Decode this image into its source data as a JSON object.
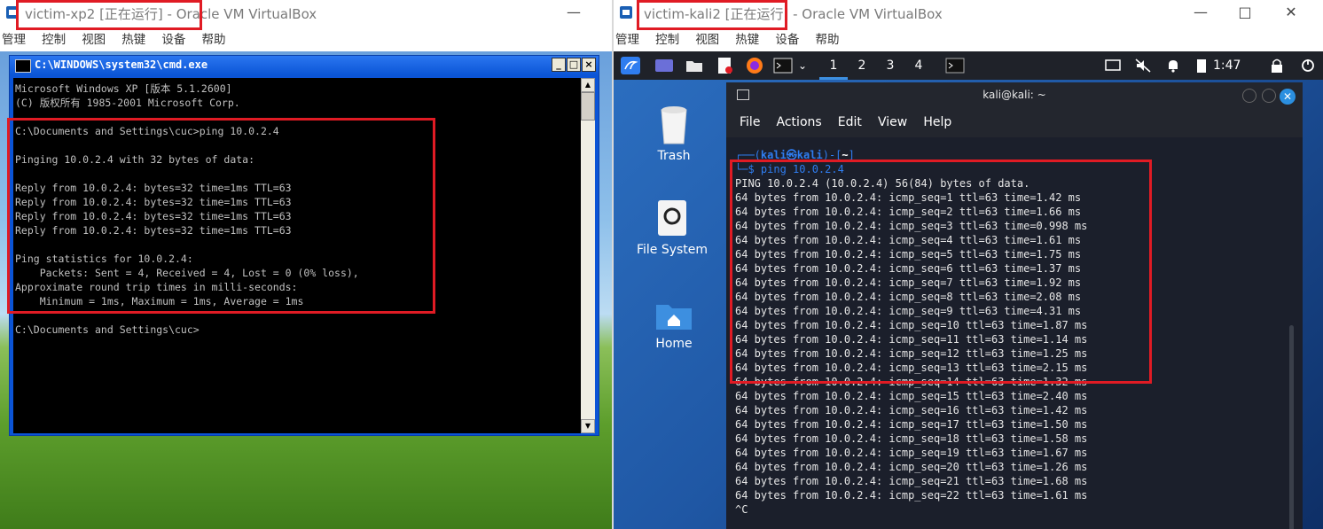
{
  "left_vm": {
    "title": "victim-xp2 [正在运行] - Oracle VM VirtualBox",
    "menu": [
      "管理",
      "控制",
      "视图",
      "热键",
      "设备",
      "帮助"
    ],
    "cmd": {
      "title": "C:\\WINDOWS\\system32\\cmd.exe",
      "lines": [
        "Microsoft Windows XP [版本 5.1.2600]",
        "(C) 版权所有 1985-2001 Microsoft Corp.",
        "",
        "C:\\Documents and Settings\\cuc>ping 10.0.2.4",
        "",
        "Pinging 10.0.2.4 with 32 bytes of data:",
        "",
        "Reply from 10.0.2.4: bytes=32 time=1ms TTL=63",
        "Reply from 10.0.2.4: bytes=32 time=1ms TTL=63",
        "Reply from 10.0.2.4: bytes=32 time=1ms TTL=63",
        "Reply from 10.0.2.4: bytes=32 time=1ms TTL=63",
        "",
        "Ping statistics for 10.0.2.4:",
        "    Packets: Sent = 4, Received = 4, Lost = 0 (0% loss),",
        "Approximate round trip times in milli-seconds:",
        "    Minimum = 1ms, Maximum = 1ms, Average = 1ms",
        "",
        "C:\\Documents and Settings\\cuc>"
      ]
    }
  },
  "right_vm": {
    "title": "victim-kali2 [正在运行] - Oracle VM VirtualBox",
    "menu": [
      "管理",
      "控制",
      "视图",
      "热键",
      "设备",
      "帮助"
    ],
    "panel": {
      "workspaces": [
        "1",
        "2",
        "3",
        "4"
      ],
      "clock": "1:47"
    },
    "desktop_icons": [
      "Trash",
      "File System",
      "Home"
    ],
    "terminal": {
      "title": "kali@kali: ~",
      "menu": [
        "File",
        "Actions",
        "Edit",
        "View",
        "Help"
      ],
      "prompt_user": "kali㉿kali",
      "prompt_dir": "~",
      "command": "ping 10.0.2.4",
      "header": "PING 10.0.2.4 (10.0.2.4) 56(84) bytes of data.",
      "replies": [
        "64 bytes from 10.0.2.4: icmp_seq=1 ttl=63 time=1.42 ms",
        "64 bytes from 10.0.2.4: icmp_seq=2 ttl=63 time=1.66 ms",
        "64 bytes from 10.0.2.4: icmp_seq=3 ttl=63 time=0.998 ms",
        "64 bytes from 10.0.2.4: icmp_seq=4 ttl=63 time=1.61 ms",
        "64 bytes from 10.0.2.4: icmp_seq=5 ttl=63 time=1.75 ms",
        "64 bytes from 10.0.2.4: icmp_seq=6 ttl=63 time=1.37 ms",
        "64 bytes from 10.0.2.4: icmp_seq=7 ttl=63 time=1.92 ms",
        "64 bytes from 10.0.2.4: icmp_seq=8 ttl=63 time=2.08 ms",
        "64 bytes from 10.0.2.4: icmp_seq=9 ttl=63 time=4.31 ms",
        "64 bytes from 10.0.2.4: icmp_seq=10 ttl=63 time=1.87 ms",
        "64 bytes from 10.0.2.4: icmp_seq=11 ttl=63 time=1.14 ms",
        "64 bytes from 10.0.2.4: icmp_seq=12 ttl=63 time=1.25 ms",
        "64 bytes from 10.0.2.4: icmp_seq=13 ttl=63 time=2.15 ms",
        "64 bytes from 10.0.2.4: icmp_seq=14 ttl=63 time=1.32 ms",
        "64 bytes from 10.0.2.4: icmp_seq=15 ttl=63 time=2.40 ms",
        "64 bytes from 10.0.2.4: icmp_seq=16 ttl=63 time=1.42 ms",
        "64 bytes from 10.0.2.4: icmp_seq=17 ttl=63 time=1.50 ms",
        "64 bytes from 10.0.2.4: icmp_seq=18 ttl=63 time=1.58 ms",
        "64 bytes from 10.0.2.4: icmp_seq=19 ttl=63 time=1.67 ms",
        "64 bytes from 10.0.2.4: icmp_seq=20 ttl=63 time=1.26 ms",
        "64 bytes from 10.0.2.4: icmp_seq=21 ttl=63 time=1.68 ms",
        "64 bytes from 10.0.2.4: icmp_seq=22 ttl=63 time=1.61 ms"
      ],
      "interrupt": "^C"
    }
  },
  "colors": {
    "highlight_red": "#e01b24",
    "xp_titlebar": "#0a55d6",
    "kali_prompt_blue": "#2f7df0",
    "kali_terminal_bg": "#1b1f2b"
  }
}
